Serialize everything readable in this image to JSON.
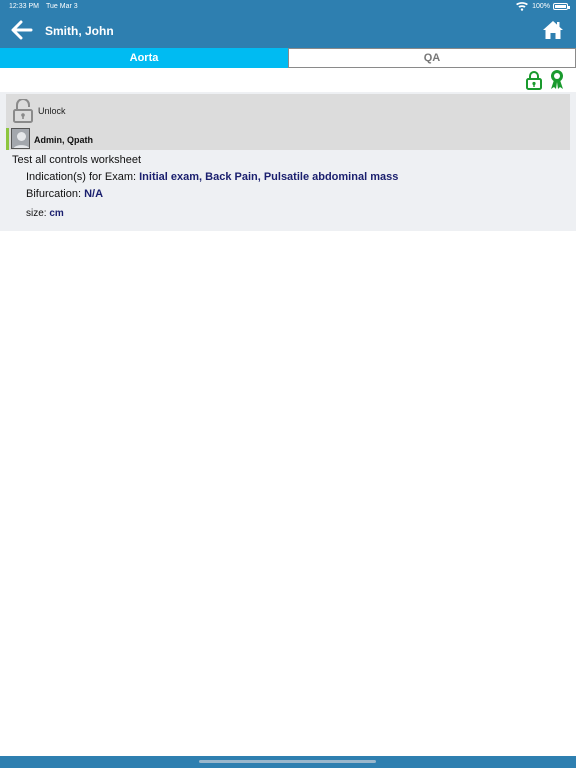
{
  "status_bar": {
    "time": "12:33 PM",
    "date": "Tue Mar 3",
    "battery": "100%"
  },
  "header": {
    "title": "Smith, John"
  },
  "tabs": [
    {
      "label": "Aorta",
      "active": true
    },
    {
      "label": "QA",
      "active": false
    }
  ],
  "icons": {
    "lock": "lock-icon",
    "ribbon": "award-ribbon-icon",
    "home": "home-icon",
    "back": "arrow-left-icon"
  },
  "signature": {
    "unlock_label": "Unlock",
    "user_name": "Admin, Qpath"
  },
  "worksheet": {
    "title": "Test all controls worksheet",
    "fields": [
      {
        "label": "Indication(s) for Exam:",
        "value": "Initial exam, Back Pain, Pulsatile abdominal mass"
      },
      {
        "label": "Bifurcation:",
        "value": "N/A"
      },
      {
        "label": "size:",
        "value": "cm"
      }
    ]
  },
  "colors": {
    "header": "#2e7fb0",
    "active_tab": "#00bbf2",
    "icon_green": "#1a9a2e",
    "value_text": "#1a1f6e"
  }
}
